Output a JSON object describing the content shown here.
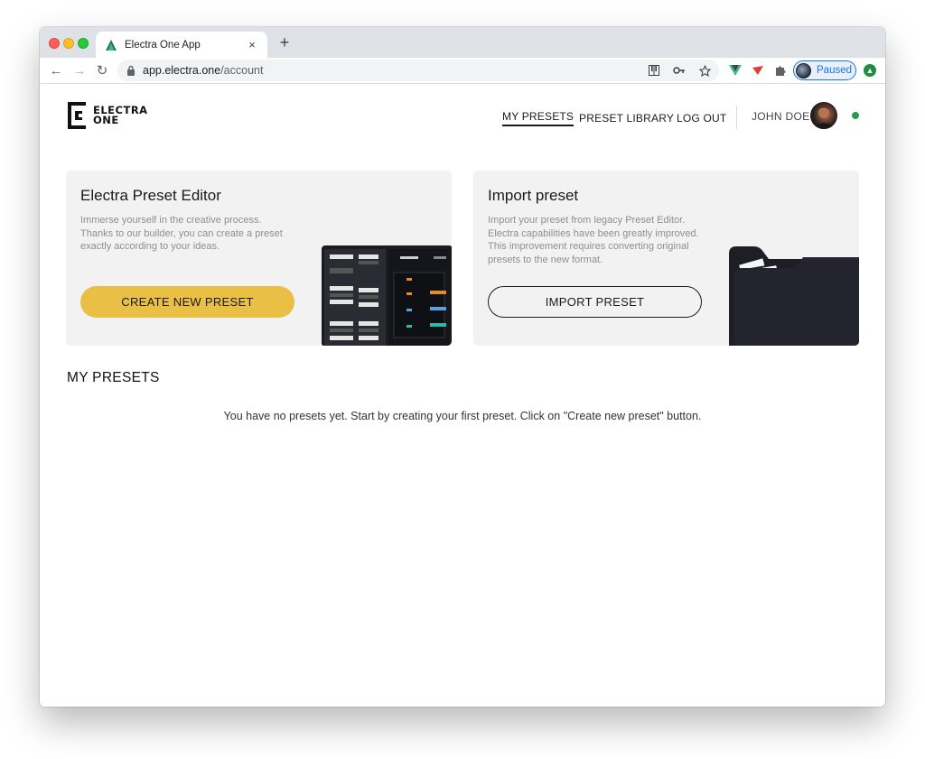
{
  "browser": {
    "tab": {
      "title": "Electra One App",
      "close_glyph": "×",
      "favicon": "electra-favicon-icon"
    },
    "new_tab_glyph": "+",
    "nav": {
      "back_glyph": "←",
      "forward_glyph": "→",
      "reload_glyph": "↻"
    },
    "address": {
      "host": "app.electra.one",
      "path": "/account"
    },
    "profile": {
      "label": "Paused"
    },
    "colors": {
      "tab_strip": "#dee1e6",
      "accent": "#1a73e8"
    }
  },
  "header": {
    "logo": {
      "line1": "ELECTRA",
      "line2": "ONE"
    },
    "nav": {
      "my_presets": "MY PRESETS",
      "preset_library": "PRESET LIBRARY",
      "log_out": "LOG OUT"
    },
    "user": {
      "name": "JOHN DOE",
      "status_color": "#1fa14a"
    }
  },
  "cards": {
    "editor": {
      "title": "Electra Preset Editor",
      "description": "Immerse yourself in the creative process. Thanks to our builder, you can create a preset exactly according to your ideas.",
      "button": "CREATE NEW PRESET",
      "button_color": "#e9bf45"
    },
    "import": {
      "title": "Import preset",
      "description": "Import your preset from legacy Preset Editor. Electra capabilities have been greatly improved. This improvement requires converting original presets to the new format.",
      "button": "IMPORT PRESET"
    }
  },
  "presets": {
    "section_title": "MY PRESETS",
    "empty_message": "You have no presets yet. Start by creating your first preset. Click on \"Create new preset\" button."
  }
}
